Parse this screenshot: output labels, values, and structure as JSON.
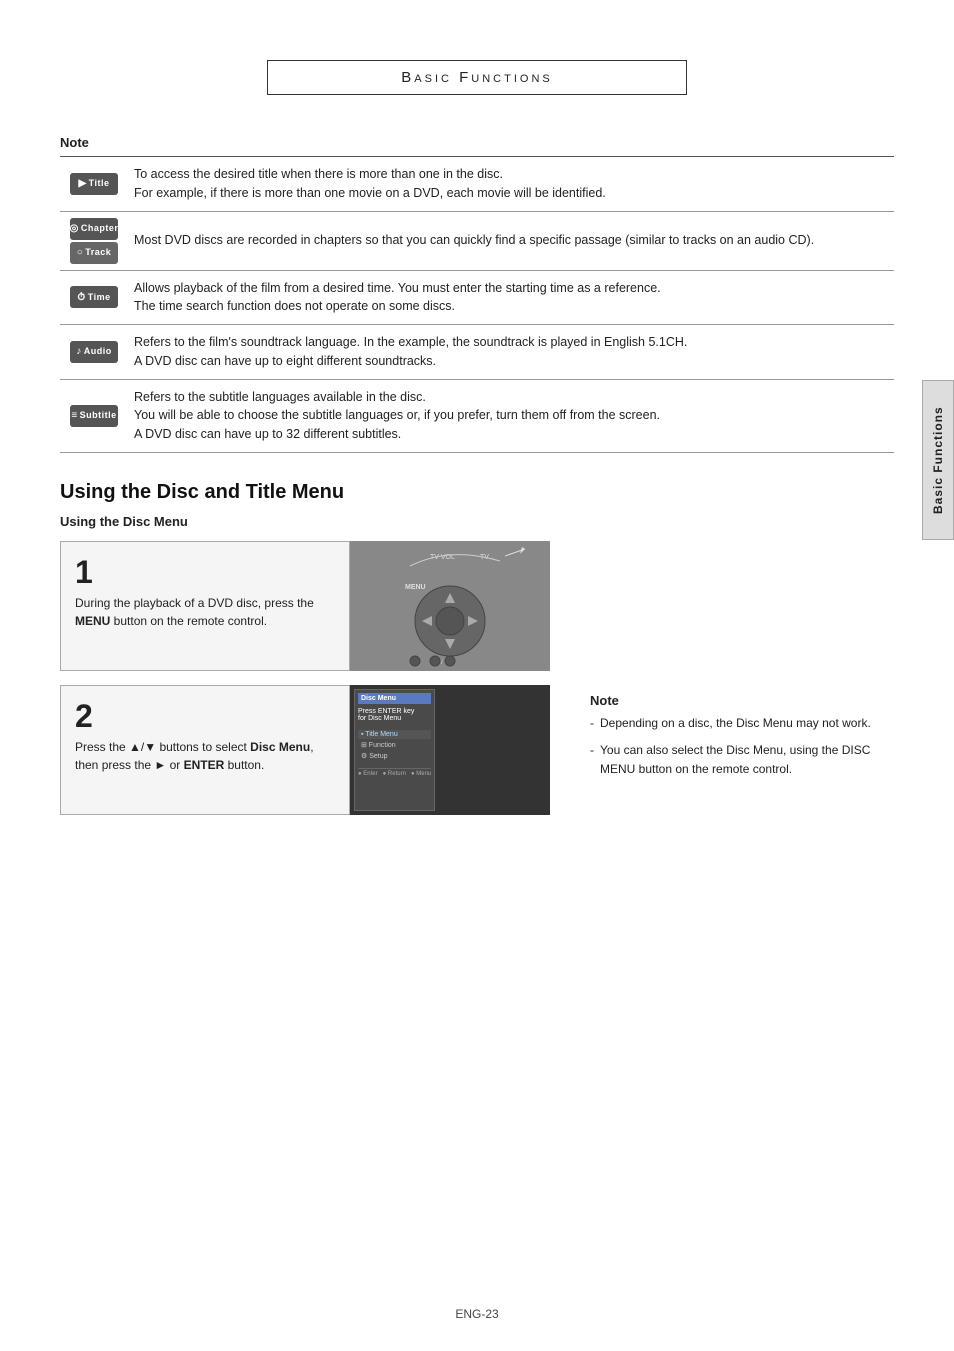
{
  "page": {
    "title": "Basic Functions",
    "footer": "ENG-23"
  },
  "side_tab": {
    "label": "Basic Functions"
  },
  "note_section": {
    "label": "Note",
    "rows": [
      {
        "icon_label": "Title",
        "icon_symbol": "▶",
        "text": "To access the desired title when there is more than one in the disc.\nFor example, if there is more than one movie on a DVD, each movie will be identified."
      },
      {
        "icon_label": "Chapter",
        "icon2_label": "Track",
        "icon_symbol": "◎",
        "text": "Most DVD discs are recorded in chapters so that you can quickly find a specific passage (similar to tracks on an audio CD)."
      },
      {
        "icon_label": "Time",
        "icon_symbol": "⏱",
        "text": "Allows playback of the film from a desired time. You must enter the starting time as a reference.\nThe time search function does not operate on some discs."
      },
      {
        "icon_label": "Audio",
        "icon_symbol": "♪",
        "text": "Refers to the film's soundtrack language. In the example, the soundtrack is played in English 5.1CH.\nA DVD disc can have up to eight different soundtracks."
      },
      {
        "icon_label": "Subtitle",
        "icon_symbol": "≡",
        "text": "Refers to the subtitle languages available in the disc.\nYou will be able to choose the subtitle languages or, if you prefer, turn them off from the screen.\nA DVD disc can have up to 32 different subtitles."
      }
    ]
  },
  "disc_title_section": {
    "heading": "Using the Disc and Title Menu",
    "subheading": "Using the Disc Menu",
    "step1": {
      "number": "1",
      "text_before_bold": "During the playback of a DVD disc, press the ",
      "bold_text": "MENU",
      "text_after": " button on the remote control."
    },
    "step2": {
      "number": "2",
      "text_before_bold1": "Press the ▲/▼ buttons to select ",
      "bold_text1": "Disc Menu",
      "text_between": ", then press the ► or ",
      "bold_text2": "ENTER",
      "text_after": " button."
    },
    "note": {
      "label": "Note",
      "items": [
        "Depending on a disc, the Disc Menu may not work.",
        "You can also select the Disc Menu, using the DISC MENU button on the remote control."
      ]
    },
    "menu_screen": {
      "title": "Disc Menu",
      "subtitle": "Press ENTER key for Disc Menu",
      "items": [
        "Title Menu",
        "Function",
        "Setup"
      ],
      "bottom": [
        "Enter",
        "Return",
        "Menu"
      ]
    }
  }
}
